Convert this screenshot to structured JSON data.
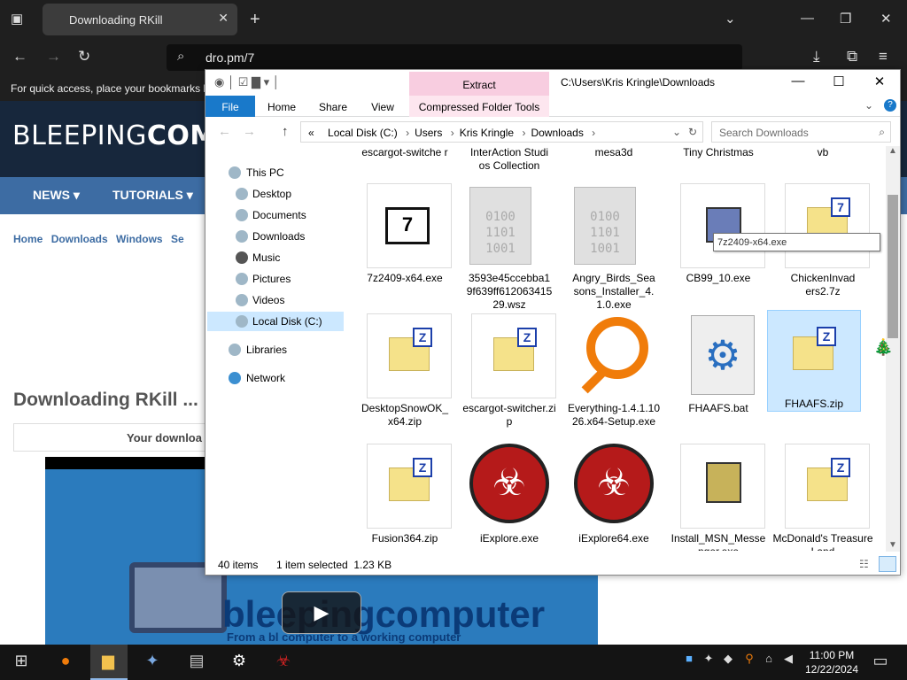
{
  "browser": {
    "tab_title": "Downloading RKill",
    "tab_close": "✕",
    "new_tab": "+",
    "url": "dro.pm/7",
    "bookmarks_hint": "For quick access, place your bookmarks h",
    "window_controls": {
      "minimize": "—",
      "maximize": "❐",
      "close": "✕"
    },
    "toolbar_icons": [
      "download-icon",
      "extensions-icon",
      "menu-icon"
    ]
  },
  "website": {
    "logo_light": "BLEEPING",
    "logo_bold": "COMPU",
    "nav": [
      "NEWS ▾",
      "TUTORIALS ▾"
    ],
    "breadcrumbs": [
      "Home",
      "Downloads",
      "Windows",
      "Se"
    ],
    "heading": "Downloading RKill ...",
    "download_text": "Your downloa",
    "video_watermark": "bleepingcomputer",
    "video_subtitle": "From a bl        computer to a working computer",
    "play_symbol": "▶"
  },
  "explorer": {
    "extract_tab": "Extract",
    "title_path": "C:\\Users\\Kris Kringle\\Downloads",
    "ribbon_tabs": [
      "File",
      "Home",
      "Share",
      "View",
      "Compressed Folder Tools"
    ],
    "address": [
      "Local Disk (C:)",
      "Users",
      "Kris Kringle",
      "Downloads"
    ],
    "address_prefix": "«",
    "search_placeholder": "Search Downloads",
    "nav_items": [
      {
        "label": "This PC"
      },
      {
        "label": "Desktop"
      },
      {
        "label": "Documents"
      },
      {
        "label": "Downloads"
      },
      {
        "label": "Music"
      },
      {
        "label": "Pictures"
      },
      {
        "label": "Videos"
      },
      {
        "label": "Local Disk (C:)"
      },
      {
        "label": "Libraries"
      },
      {
        "label": "Network"
      }
    ],
    "top_row_partial": [
      "escargot-switche r",
      "InterAction Studios Collection",
      "mesa3d",
      "Tiny Christmas",
      "vb"
    ],
    "files_row1": [
      {
        "name": "7z2409-x64.exe",
        "icon": "7zip-exe-icon"
      },
      {
        "name": "3593e45ccebba19f639ff61206341529.wsz",
        "icon": "binary-file-icon"
      },
      {
        "name": "Angry_Birds_Seasons_Installer_4.1.0.exe",
        "icon": "binary-file-icon"
      },
      {
        "name": "CB99_10.exe",
        "icon": "installer-icon"
      },
      {
        "name": "ChickenInvaders2.7z",
        "icon": "zip-icon"
      }
    ],
    "files_row2": [
      {
        "name": "DesktopSnowOK_x64.zip",
        "icon": "zip-icon"
      },
      {
        "name": "escargot-switcher.zip",
        "icon": "zip-icon"
      },
      {
        "name": "Everything-1.4.1.1026.x64-Setup.exe",
        "icon": "magnifier-icon"
      },
      {
        "name": "FHAAFS.bat",
        "icon": "gear-file-icon"
      },
      {
        "name": "FHAAFS.zip",
        "icon": "zip-icon"
      }
    ],
    "files_row3": [
      {
        "name": "Fusion364.zip",
        "icon": "zip-icon"
      },
      {
        "name": "iExplore.exe",
        "icon": "biohazard-icon"
      },
      {
        "name": "iExplore64.exe",
        "icon": "biohazard-icon"
      },
      {
        "name": "Install_MSN_Messenger.exe",
        "icon": "installer-icon"
      },
      {
        "name": "McDonald's Treasure Land",
        "icon": "zip-icon"
      }
    ],
    "selected_file": "FHAAFS.zip",
    "tooltip": "7z2409-x64.exe",
    "status_items": "40 items",
    "status_selected": "1 item selected  1.23 KB"
  },
  "taskbar": {
    "time": "11:00 PM",
    "date": "12/22/2024",
    "apps": [
      "start-icon",
      "firefox-icon",
      "file-explorer-icon",
      "app-icon",
      "notepad-icon",
      "settings-icon",
      "rkill-icon"
    ]
  }
}
